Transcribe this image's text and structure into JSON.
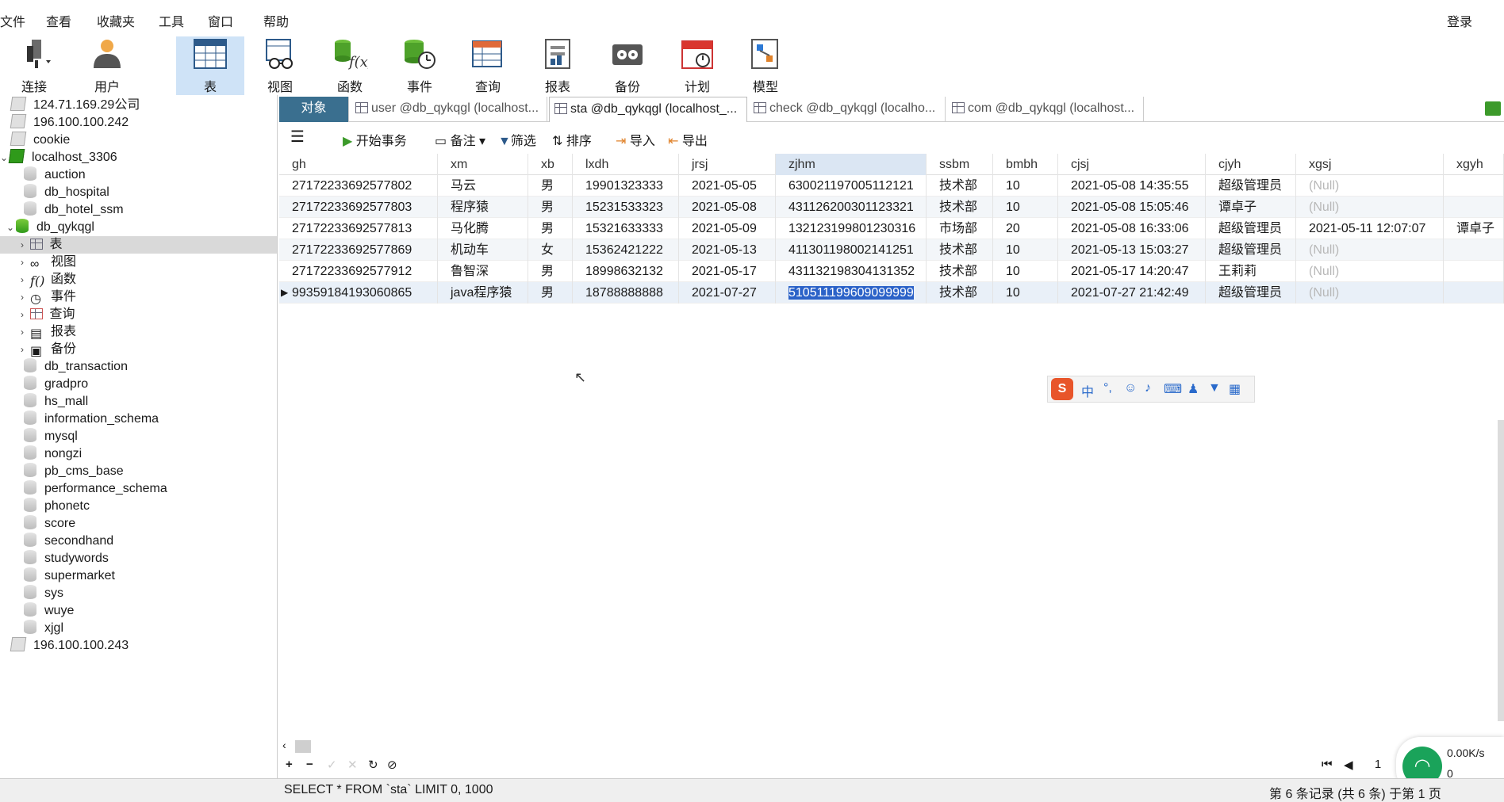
{
  "menu": {
    "items": [
      "文件",
      "查看",
      "收藏夹",
      "工具",
      "窗口",
      "帮助"
    ],
    "login": "登录"
  },
  "toolbar": {
    "buttons": [
      {
        "label": "连接",
        "icon": "plug-icon"
      },
      {
        "label": "用户",
        "icon": "user-icon"
      },
      {
        "label": "表",
        "icon": "table-icon"
      },
      {
        "label": "视图",
        "icon": "view-glasses-icon"
      },
      {
        "label": "函数",
        "icon": "function-icon"
      },
      {
        "label": "事件",
        "icon": "event-clock-icon"
      },
      {
        "label": "查询",
        "icon": "query-icon"
      },
      {
        "label": "报表",
        "icon": "report-icon"
      },
      {
        "label": "备份",
        "icon": "backup-icon"
      },
      {
        "label": "计划",
        "icon": "schedule-calendar-icon"
      },
      {
        "label": "模型",
        "icon": "model-icon"
      }
    ],
    "active": "表"
  },
  "sidebar": {
    "items": [
      {
        "label": "124.71.169.29公司"
      },
      {
        "label": "196.100.100.242"
      },
      {
        "label": "cookie"
      },
      {
        "label": "localhost_3306"
      },
      {
        "label": "auction"
      },
      {
        "label": "db_hospital"
      },
      {
        "label": "db_hotel_ssm"
      },
      {
        "label": "db_qykqgl"
      },
      {
        "label": "表"
      },
      {
        "label": "视图"
      },
      {
        "label": "函数"
      },
      {
        "label": "事件"
      },
      {
        "label": "查询"
      },
      {
        "label": "报表"
      },
      {
        "label": "备份"
      },
      {
        "label": "db_transaction"
      },
      {
        "label": "gradpro"
      },
      {
        "label": "hs_mall"
      },
      {
        "label": "information_schema"
      },
      {
        "label": "mysql"
      },
      {
        "label": "nongzi"
      },
      {
        "label": "pb_cms_base"
      },
      {
        "label": "performance_schema"
      },
      {
        "label": "phonetc"
      },
      {
        "label": "score"
      },
      {
        "label": "secondhand"
      },
      {
        "label": "studywords"
      },
      {
        "label": "supermarket"
      },
      {
        "label": "sys"
      },
      {
        "label": "wuye"
      },
      {
        "label": "xjgl"
      },
      {
        "label": "196.100.100.243"
      }
    ]
  },
  "tabs": [
    {
      "label": "对象"
    },
    {
      "label": "user @db_qykqgl (localhost..."
    },
    {
      "label": "sta @db_qykqgl (localhost_..."
    },
    {
      "label": "check @db_qykqgl (localho..."
    },
    {
      "label": "com @db_qykqgl (localhost..."
    }
  ],
  "subbar": {
    "begin_tx": "开始事务",
    "note": "备注",
    "filter": "筛选",
    "sort": "排序",
    "import": "导入",
    "export": "导出"
  },
  "table": {
    "columns": [
      "gh",
      "xm",
      "xb",
      "lxdh",
      "jrsj",
      "zjhm",
      "ssbm",
      "bmbh",
      "cjsj",
      "cjyh",
      "xgsj",
      "xgyh"
    ],
    "rows": [
      [
        "27172233692577802",
        "马云",
        "男",
        "19901323333",
        "2021-05-05",
        "630021197005112121",
        "技术部",
        "10",
        "2021-05-08 14:35:55",
        "超级管理员",
        "(Null)",
        ""
      ],
      [
        "27172233692577803",
        "程序猿",
        "男",
        "15231533323",
        "2021-05-08",
        "431126200301123321",
        "技术部",
        "10",
        "2021-05-08 15:05:46",
        "谭卓子",
        "(Null)",
        ""
      ],
      [
        "27172233692577813",
        "马化腾",
        "男",
        "15321633333",
        "2021-05-09",
        "132123199801230316",
        "市场部",
        "20",
        "2021-05-08 16:33:06",
        "超级管理员",
        "2021-05-11 12:07:07",
        "谭卓子"
      ],
      [
        "27172233692577869",
        "机动车",
        "女",
        "15362421222",
        "2021-05-13",
        "411301198002141251",
        "技术部",
        "10",
        "2021-05-13 15:03:27",
        "超级管理员",
        "(Null)",
        ""
      ],
      [
        "27172233692577912",
        "鲁智深",
        "男",
        "18998632132",
        "2021-05-17",
        "431132198304131352",
        "技术部",
        "10",
        "2021-05-17 14:20:47",
        "王莉莉",
        "(Null)",
        ""
      ],
      [
        "99359184193060865",
        "java程序猿",
        "男",
        "18788888888",
        "2021-07-27",
        "510511199609099999",
        "技术部",
        "10",
        "2021-07-27 21:42:49",
        "超级管理员",
        "(Null)",
        ""
      ]
    ]
  },
  "ime": {
    "lang": "中",
    "punct": "°,"
  },
  "pager": {
    "page": "1"
  },
  "network": {
    "speed": "0.00K/s",
    "count": "0"
  },
  "status": {
    "sql": "SELECT * FROM `sta` LIMIT 0, 1000",
    "info": "第 6 条记录 (共 6 条) 于第 1 页"
  }
}
